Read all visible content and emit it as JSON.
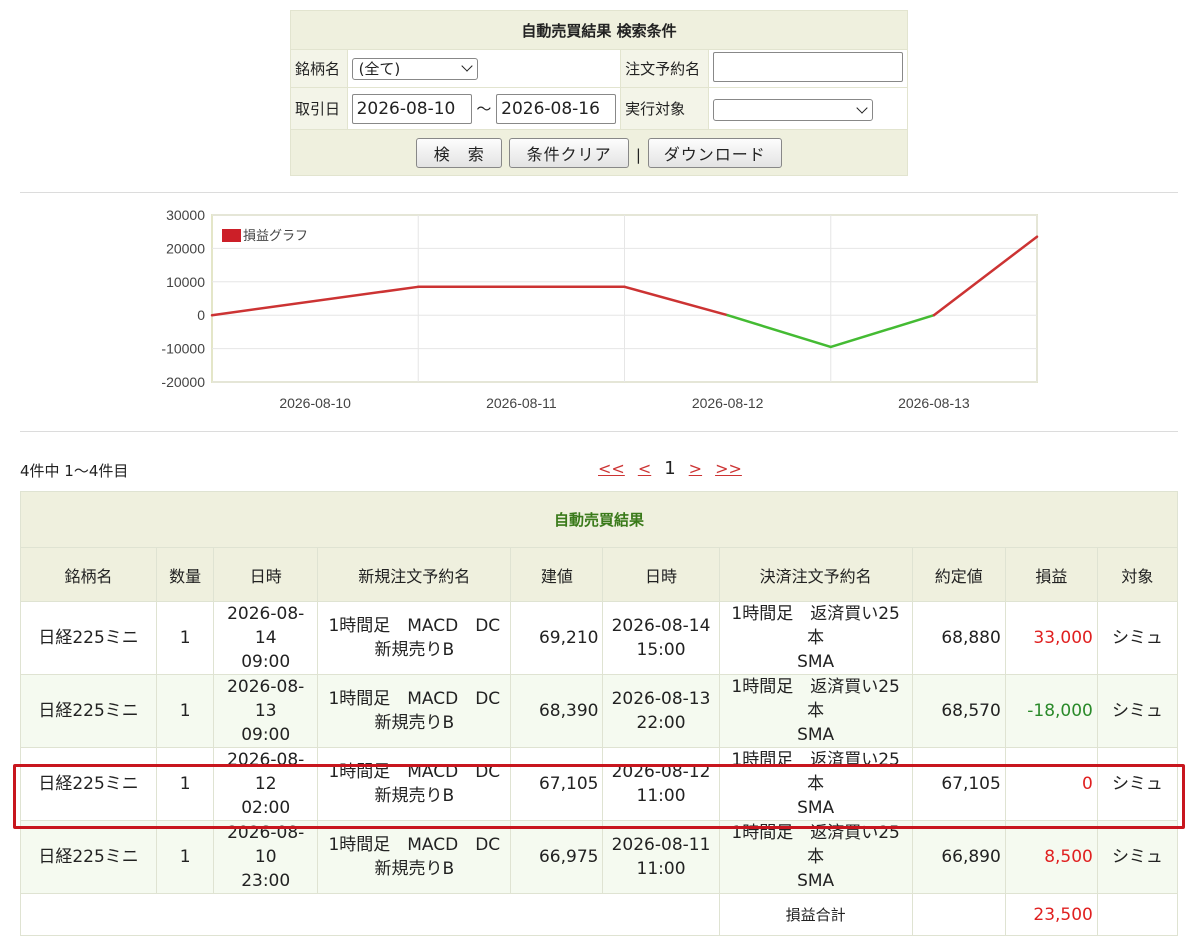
{
  "search": {
    "title": "自動売買結果 検索条件",
    "brand_label": "銘柄名",
    "brand_value": "(全て)",
    "order_name_label": "注文予約名",
    "order_name_value": "",
    "date_label": "取引日",
    "date_from": "2026-08-10",
    "date_sep": "〜",
    "date_to": "2026-08-16",
    "target_label": "実行対象",
    "target_value": "",
    "search_button": "検　索",
    "clear_button": "条件クリア",
    "divider": "|",
    "download_button": "ダウンロード"
  },
  "colors": {
    "profit_line": "#cc3333",
    "loss_line": "#44bb33",
    "highlight": "#c8161e"
  },
  "chart_data": {
    "type": "line",
    "title": "",
    "legend": "損益グラフ",
    "legend_placement": "top-left",
    "grid": true,
    "x": [
      "2026-08-10",
      "2026-08-11",
      "2026-08-12",
      "2026-08-13"
    ],
    "x_range": [
      0,
      4
    ],
    "ylim": [
      -20000,
      30000
    ],
    "y_ticks": [
      30000,
      20000,
      10000,
      0,
      -10000,
      -20000
    ],
    "series": [
      {
        "name": "損益グラフ",
        "points": [
          [
            0,
            0
          ],
          [
            1,
            8500
          ],
          [
            2,
            8500
          ],
          [
            2.5,
            0
          ],
          [
            3,
            -9500
          ],
          [
            3.5,
            0
          ],
          [
            4,
            23500
          ]
        ]
      }
    ]
  },
  "pager": {
    "summary": "4件中 1〜4件目",
    "first": "<<",
    "prev": "<",
    "current": "1",
    "next": ">",
    "last": ">>"
  },
  "results": {
    "caption": "自動売買結果",
    "headers": [
      "銘柄名",
      "数量",
      "日時",
      "新規注文予約名",
      "建値",
      "日時",
      "決済注文予約名",
      "約定値",
      "損益",
      "対象"
    ],
    "rows": [
      {
        "brand": "日経225ミニ",
        "qty": "1",
        "open_date": "2026-08-14",
        "open_time": "09:00",
        "open_order_1": "1時間足　MACD　DC",
        "open_order_2": "新規売りB",
        "open_price": "69,210",
        "close_date": "2026-08-14",
        "close_time": "15:00",
        "close_order_1": "1時間足　返済買い25本",
        "close_order_2": "SMA",
        "fill_price": "68,880",
        "pnl": "33,000",
        "pnl_sign": "pos",
        "target": "シミュ"
      },
      {
        "brand": "日経225ミニ",
        "qty": "1",
        "open_date": "2026-08-13",
        "open_time": "09:00",
        "open_order_1": "1時間足　MACD　DC",
        "open_order_2": "新規売りB",
        "open_price": "68,390",
        "close_date": "2026-08-13",
        "close_time": "22:00",
        "close_order_1": "1時間足　返済買い25本",
        "close_order_2": "SMA",
        "fill_price": "68,570",
        "pnl": "-18,000",
        "pnl_sign": "neg",
        "target": "シミュ"
      },
      {
        "brand": "日経225ミニ",
        "qty": "1",
        "open_date": "2026-08-12",
        "open_time": "02:00",
        "open_order_1": "1時間足　MACD　DC",
        "open_order_2": "新規売りB",
        "open_price": "67,105",
        "close_date": "2026-08-12",
        "close_time": "11:00",
        "close_order_1": "1時間足　返済買い25本",
        "close_order_2": "SMA",
        "fill_price": "67,105",
        "pnl": "0",
        "pnl_sign": "pos",
        "target": "シミュ"
      },
      {
        "brand": "日経225ミニ",
        "qty": "1",
        "open_date": "2026-08-10",
        "open_time": "23:00",
        "open_order_1": "1時間足　MACD　DC",
        "open_order_2": "新規売りB",
        "open_price": "66,975",
        "close_date": "2026-08-11",
        "close_time": "11:00",
        "close_order_1": "1時間足　返済買い25本",
        "close_order_2": "SMA",
        "fill_price": "66,890",
        "pnl": "8,500",
        "pnl_sign": "pos",
        "target": "シミュ"
      }
    ],
    "total_label": "損益合計",
    "total_value": "23,500"
  }
}
